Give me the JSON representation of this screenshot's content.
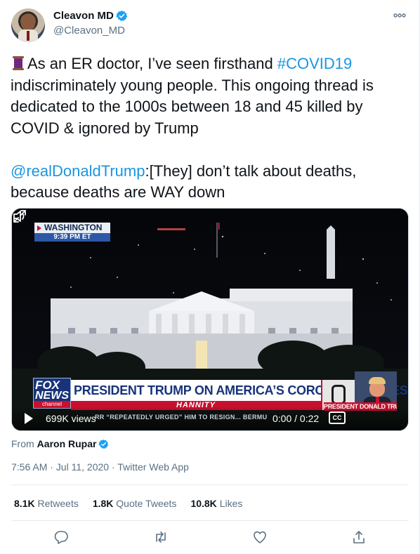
{
  "tweet": {
    "author": {
      "display_name": "Cleavon MD",
      "handle": "@Cleavon_MD",
      "verified": true
    },
    "more_icon": "more-icon",
    "text_lead": "As an ER doctor, I’ve seen firsthand ",
    "hashtag": "#COVID19",
    "text_mid": " indiscriminately young people. This ongoing thread is dedicated to the 1000s between 18 and 45 killed by COVID & ignored by Trump",
    "mention": "@realDonaldTrump",
    "quote_text": ":[They] don’t talk about deaths, because deaths are WAY down",
    "emoji_icon": "thread-spool-icon",
    "video": {
      "location": "WASHINGTON",
      "time_overlay": "9:39 PM ET",
      "logo_top": "FOX",
      "logo_bottom": "NEWS",
      "logo_channel": "channel",
      "headline": "PRESIDENT TRUMP ON AMERICA’S CORONAVIRUS RESPONSE",
      "show": "HANNITY",
      "pip_label": "PRESIDENT DONALD TRUMP",
      "ticker": "RR “REPEATEDLY URGED” HIM TO RESIGN... BERMU",
      "views": "699K views",
      "time": "0:00 / 0:22",
      "cc_label": "CC"
    },
    "from_label": "From",
    "from_name": "Aaron Rupar",
    "timestamp": "7:56 AM · Jul 11, 2020 · Twitter Web App",
    "stats": {
      "retweets_count": "8.1K",
      "retweets_label": "Retweets",
      "quotes_count": "1.8K",
      "quotes_label": "Quote Tweets",
      "likes_count": "10.8K",
      "likes_label": "Likes"
    },
    "actions": [
      "reply-icon",
      "retweet-icon",
      "like-icon",
      "share-icon"
    ]
  },
  "colors": {
    "link": "#1b95e0",
    "muted": "#5b7083",
    "verified": "#1da1f2"
  }
}
